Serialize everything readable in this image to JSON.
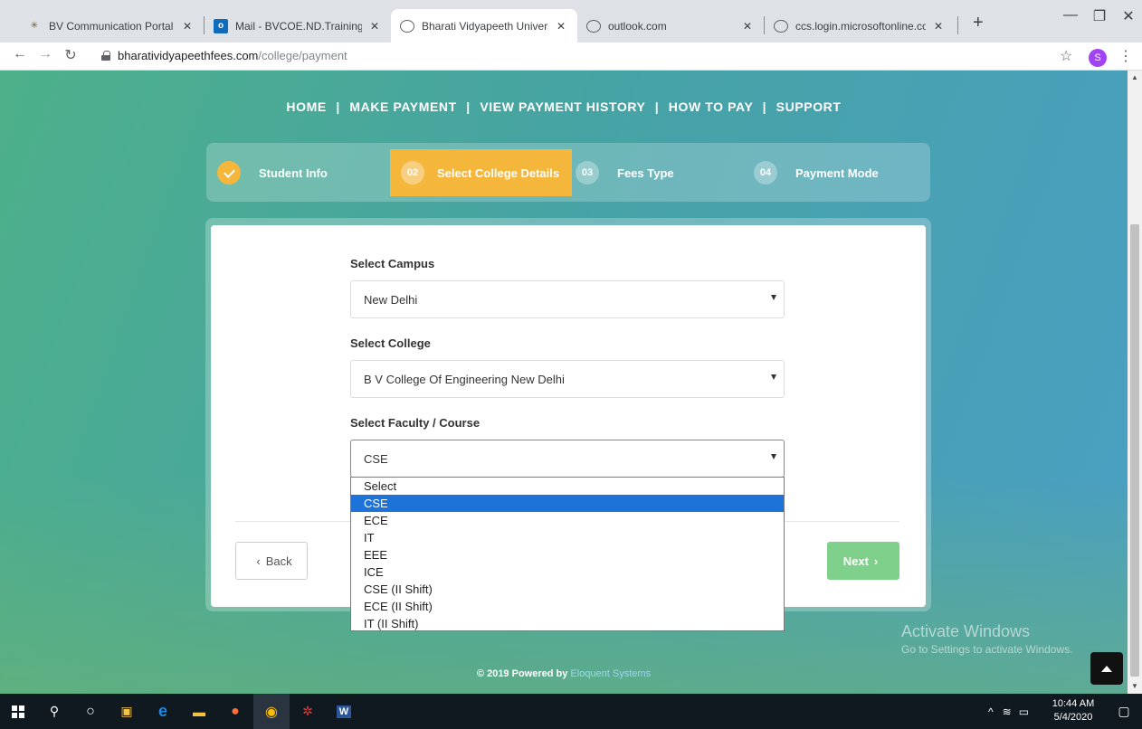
{
  "browser": {
    "tabs": [
      {
        "title": "BV Communication Portal",
        "icon": "bv-logo-icon"
      },
      {
        "title": "Mail - BVCOE.ND.Training&Pla",
        "icon": "outlook-icon"
      },
      {
        "title": "Bharati Vidyapeeth University",
        "icon": "globe-icon",
        "active": true
      },
      {
        "title": "outlook.com",
        "icon": "globe-icon"
      },
      {
        "title": "ccs.login.microsoftonline.com",
        "icon": "globe-icon"
      }
    ],
    "tab_close": "✕",
    "new_tab": "+",
    "url_host": "bharatividyapeethfees.com",
    "url_path": "/college/payment",
    "profile_initial": "S"
  },
  "nav": {
    "items": [
      "HOME",
      "MAKE PAYMENT",
      "VIEW PAYMENT HISTORY",
      "HOW TO PAY",
      "SUPPORT"
    ],
    "separator": "|"
  },
  "steps": [
    {
      "num": "",
      "label": "Student Info",
      "state": "done"
    },
    {
      "num": "02",
      "label": "Select College Details",
      "state": "active"
    },
    {
      "num": "03",
      "label": "Fees Type",
      "state": "todo"
    },
    {
      "num": "04",
      "label": "Payment Mode",
      "state": "todo"
    }
  ],
  "form": {
    "campus_label": "Select Campus",
    "campus_value": "New Delhi",
    "college_label": "Select College",
    "college_value": "B V College Of Engineering New Delhi",
    "course_label": "Select Faculty / Course",
    "course_value": "CSE",
    "course_options": [
      "Select",
      "CSE",
      "ECE",
      "IT",
      "EEE",
      "ICE",
      "CSE (II Shift)",
      "ECE (II Shift)",
      "IT (II Shift)"
    ],
    "selected_option_index": 1
  },
  "buttons": {
    "back_label": "Back",
    "next_label": "Next"
  },
  "footer": {
    "prefix": "© 2019 Powered by",
    "brand": "Eloquent Systems"
  },
  "watermark": {
    "line1": "Activate Windows",
    "line2": "Go to Settings to activate Windows."
  },
  "taskbar": {
    "time": "10:44 AM",
    "date": "5/4/2020"
  },
  "colors": {
    "accent": "#f5b63c",
    "next_button": "#7fd08a",
    "option_selected": "#1e73d8"
  }
}
